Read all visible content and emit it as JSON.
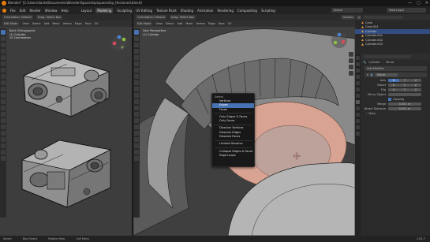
{
  "window": {
    "title": "Blender* [C:\\Users\\dante\\Documents\\Blender\\Spaceship\\spaceship_thickened.blend]",
    "controls": [
      "—",
      "▢",
      "✕"
    ]
  },
  "menubar": {
    "items": [
      "File",
      "Edit",
      "Render",
      "Window",
      "Help"
    ],
    "workspaces": [
      "Layout",
      "Modeling",
      "Sculpting",
      "UV Editing",
      "Texture Paint",
      "Shading",
      "Animation",
      "Rendering",
      "Compositing",
      "Scripting"
    ],
    "active_workspace": "Modeling",
    "scene": "Scene",
    "view_layer": "View Layer"
  },
  "left_viewport": {
    "header": [
      "Edit Mode",
      "View",
      "Select",
      "Add",
      "Mesh",
      "Vertex",
      "Edge",
      "Face",
      "UV"
    ],
    "orientation": "Orientation:",
    "orientation_value": "Default",
    "drag": "Drag:",
    "drag_value": "Select Box",
    "info_line1": "Back Orthographic",
    "info_line2": "(1) Cylinder",
    "info_line3": "10 Centimeters"
  },
  "right_viewport": {
    "header": [
      "Edit Mode",
      "View",
      "Select",
      "Add",
      "Mesh",
      "Vertex",
      "Edge",
      "Face",
      "UV"
    ],
    "orientation": "Orientation:",
    "orientation_value": "Default",
    "drag": "Drag:",
    "drag_value": "Select Box",
    "info_line1": "User Perspective",
    "info_line2": "(1) Cylinder",
    "options": "Options"
  },
  "context_menu": {
    "title": "Select",
    "group1": [
      "Vertices",
      "Edges",
      "Faces"
    ],
    "highlighted": "Edges",
    "group2": [
      "Only Edges & Faces",
      "Only Faces"
    ],
    "group3": [
      "Dissolve Vertices",
      "Dissolve Edges",
      "Dissolve Faces"
    ],
    "group4": [
      "Limited Dissolve"
    ],
    "group5": [
      "Collapse Edges & Faces",
      "Edge Loops"
    ]
  },
  "outliner": {
    "rows": [
      "Cone",
      "Cone.001",
      "Cylinder",
      "Cylinder.001",
      "Cylinder.002",
      "Cylinder.003"
    ],
    "selected": "Cylinder"
  },
  "properties": {
    "object_name": "Cylinder",
    "modifier_name": "Mirror",
    "add_modifier": "Add Modifier",
    "modifier_panel": "Mirror",
    "axis_label": "Axis",
    "bisect_label": "Bisect",
    "flip_label": "Flip",
    "axis_values": [
      "X",
      "Y",
      "Z"
    ],
    "mirror_object": "Mirror Object",
    "clipping": "Clipping",
    "merge": "Merge",
    "merge_value": "0.001 m",
    "bisect_distance": "Bisect Distance",
    "bisect_distance_value": "0.001 m",
    "data_section": "Data"
  },
  "statusbar": {
    "items": [
      "Select",
      "Box Select",
      "Rotate View",
      "Call Menu"
    ],
    "version": "2.82.7"
  },
  "colors": {
    "accent": "#4772b3",
    "selection_face": "#d8a393",
    "orange_select": "#e39b4a"
  }
}
